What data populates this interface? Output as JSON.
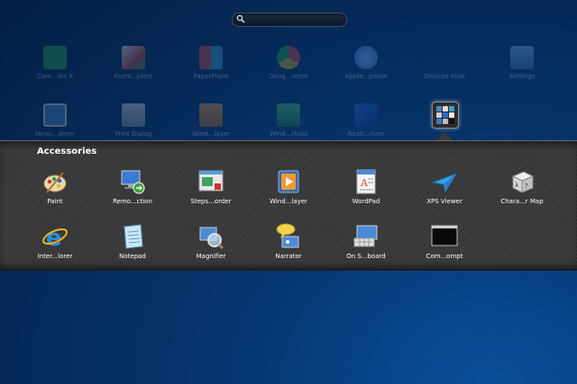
{
  "search": {
    "placeholder": "",
    "value": ""
  },
  "background_apps": [
    {
      "label": "Cam...dio 8",
      "icon": "camtasia-icon",
      "color": "#2aa34a"
    },
    {
      "label": "FastS...plore",
      "icon": "faststone-icon",
      "color": "#e0e0e0"
    },
    {
      "label": "PaperPlane",
      "icon": "paperplane-icon",
      "color": "#d64545"
    },
    {
      "label": "Goog...rome",
      "icon": "chrome-icon",
      "color": "#e0b020"
    },
    {
      "label": "Apple...pdate",
      "icon": "apple-update-icon",
      "color": "#3b7ad0"
    },
    {
      "label": "Devices Flow",
      "icon": "devices-flow-icon",
      "color": "#2a4a70"
    },
    {
      "label": "Settings",
      "icon": "settings-icon",
      "color": "#4a88c8"
    },
    {
      "label": "Mirac...derer",
      "icon": "miracast-icon",
      "color": "#4a88c8"
    },
    {
      "label": "Print Dialog",
      "icon": "printer-icon",
      "color": "#bbbbbb"
    },
    {
      "label": "Wind...layer",
      "icon": "media-player-icon",
      "color": "#d08a30"
    },
    {
      "label": "Wind...rtials",
      "icon": "essentials-icon",
      "color": "#3aa050"
    },
    {
      "label": "Realt...river",
      "icon": "realtek-icon",
      "color": "#2a6ad0"
    }
  ],
  "folder": {
    "title": "Accessories",
    "apps": [
      {
        "label": "Paint",
        "icon": "paint-icon"
      },
      {
        "label": "Remo...ction",
        "icon": "remote-desktop-icon"
      },
      {
        "label": "Steps...order",
        "icon": "steps-recorder-icon"
      },
      {
        "label": "Wind...layer",
        "icon": "media-player-icon"
      },
      {
        "label": "WordPad",
        "icon": "wordpad-icon"
      },
      {
        "label": "XPS Viewer",
        "icon": "xps-viewer-icon"
      },
      {
        "label": "Chara...r Map",
        "icon": "character-map-icon"
      },
      {
        "label": "Inter...lorer",
        "icon": "internet-explorer-icon"
      },
      {
        "label": "Notepad",
        "icon": "notepad-icon"
      },
      {
        "label": "Magnifier",
        "icon": "magnifier-icon"
      },
      {
        "label": "Narrator",
        "icon": "narrator-icon"
      },
      {
        "label": "On S...board",
        "icon": "on-screen-keyboard-icon"
      },
      {
        "label": "Com...ompt",
        "icon": "command-prompt-icon"
      }
    ]
  }
}
